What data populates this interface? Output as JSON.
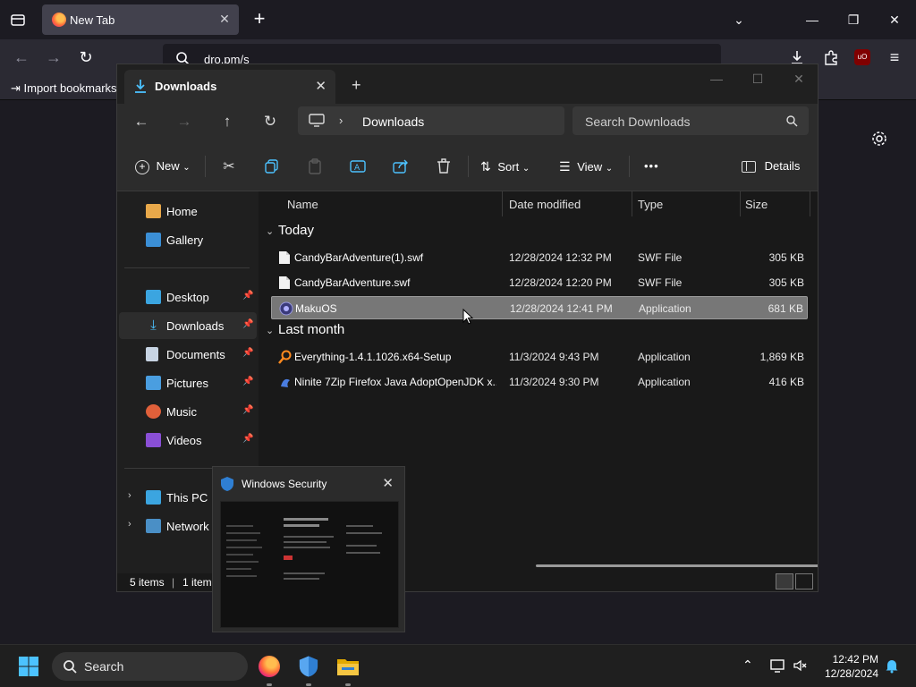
{
  "browser": {
    "tab_title": "New Tab",
    "url": "dro.pm/s",
    "bookmarks_import": "Import bookmarks..."
  },
  "explorer": {
    "tab_title": "Downloads",
    "breadcrumb": "Downloads",
    "search_placeholder": "Search Downloads",
    "toolbar": {
      "new_label": "New",
      "sort_label": "Sort",
      "view_label": "View",
      "more_label": "•••",
      "details_label": "Details"
    },
    "sidebar": {
      "home": "Home",
      "gallery": "Gallery",
      "desktop": "Desktop",
      "downloads": "Downloads",
      "documents": "Documents",
      "pictures": "Pictures",
      "music": "Music",
      "videos": "Videos",
      "this_pc": "This PC",
      "network": "Network"
    },
    "columns": {
      "name": "Name",
      "date": "Date modified",
      "type": "Type",
      "size": "Size"
    },
    "groups": {
      "today": "Today",
      "last_month": "Last month"
    },
    "files": [
      {
        "name": "CandyBarAdventure(1).swf",
        "date": "12/28/2024 12:32 PM",
        "type": "SWF File",
        "size": "305 KB"
      },
      {
        "name": "CandyBarAdventure.swf",
        "date": "12/28/2024 12:20 PM",
        "type": "SWF File",
        "size": "305 KB"
      },
      {
        "name": "MakuOS",
        "date": "12/28/2024 12:41 PM",
        "type": "Application",
        "size": "681 KB"
      },
      {
        "name": "Everything-1.4.1.1026.x64-Setup",
        "date": "11/3/2024 9:43 PM",
        "type": "Application",
        "size": "1,869 KB"
      },
      {
        "name": "Ninite 7Zip Firefox Java AdoptOpenJDK x...",
        "date": "11/3/2024 9:30 PM",
        "type": "Application",
        "size": "416 KB"
      }
    ],
    "status": {
      "items": "5 items",
      "selected": "1 item"
    }
  },
  "security_popup": {
    "title": "Windows Security"
  },
  "taskbar": {
    "search_label": "Search",
    "time": "12:42 PM",
    "date": "12/28/2024"
  },
  "colors": {
    "accent": "#4cc2ff",
    "selected_row": "#777777",
    "folder": "#f4c542"
  }
}
